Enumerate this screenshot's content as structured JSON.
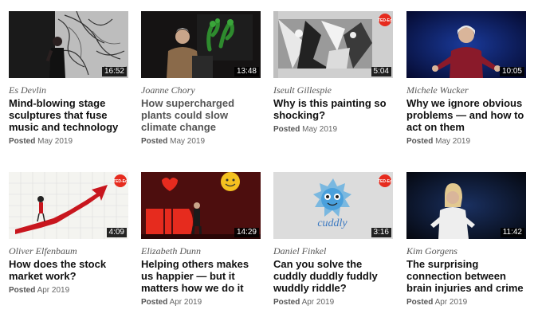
{
  "talks": [
    {
      "speaker": "Es Devlin",
      "title": "Mind-blowing stage sculptures that fuse music and technology",
      "duration": "16:52",
      "posted_label": "Posted",
      "posted_date": "May 2019",
      "visited": false,
      "thumb": "stage-performer-sketch"
    },
    {
      "speaker": "Joanne Chory",
      "title": "How supercharged plants could slow climate change",
      "duration": "13:48",
      "posted_label": "Posted",
      "posted_date": "May 2019",
      "visited": true,
      "thumb": "speaker-plants-screen"
    },
    {
      "speaker": "Iseult Gillespie",
      "title": "Why is this painting so shocking?",
      "duration": "5:04",
      "posted_label": "Posted",
      "posted_date": "May 2019",
      "visited": false,
      "thumb": "guernica-painting"
    },
    {
      "speaker": "Michele Wucker",
      "title": "Why we ignore obvious problems — and how to act on them",
      "duration": "10:05",
      "posted_label": "Posted",
      "posted_date": "May 2019",
      "visited": false,
      "thumb": "speaker-blue-stage"
    },
    {
      "speaker": "Oliver Elfenbaum",
      "title": "How does the stock market work?",
      "duration": "4:09",
      "posted_label": "Posted",
      "posted_date": "Apr 2019",
      "visited": false,
      "thumb": "rising-arrow-animation"
    },
    {
      "speaker": "Elizabeth Dunn",
      "title": "Helping others makes us happier — but it matters how we do it",
      "duration": "14:29",
      "posted_label": "Posted",
      "posted_date": "Apr 2019",
      "visited": false,
      "thumb": "speaker-red-stage"
    },
    {
      "speaker": "Daniel Finkel",
      "title": "Can you solve the cuddly duddly fuddly wuddly riddle?",
      "duration": "3:16",
      "posted_label": "Posted",
      "posted_date": "Apr 2019",
      "visited": false,
      "thumb": "cuddly-creature-animation"
    },
    {
      "speaker": "Kim Gorgens",
      "title": "The surprising connection between brain injuries and crime",
      "duration": "11:42",
      "posted_label": "Posted",
      "posted_date": "Apr 2019",
      "visited": false,
      "thumb": "speaker-dark-stage"
    }
  ],
  "colors": {
    "ted_red": "#e62b1e",
    "title_text": "#111111",
    "visited_title": "#555555",
    "meta_text": "#666666"
  },
  "icons": {
    "ted_badge": "ted-logo-icon"
  }
}
